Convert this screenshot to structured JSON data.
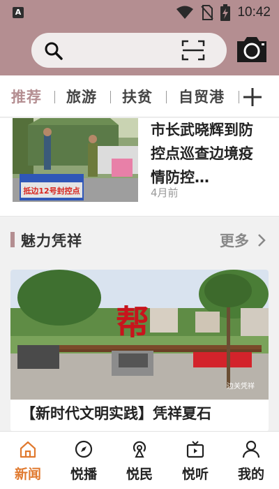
{
  "status_bar": {
    "time": "10:42",
    "app_icon_letter": "A",
    "icons": [
      "wifi-icon",
      "no-sim-icon",
      "battery-charging-icon"
    ]
  },
  "search": {
    "placeholder": "",
    "icons": [
      "search-icon",
      "scan-icon",
      "camera-icon"
    ]
  },
  "tabs": [
    {
      "label": "推荐",
      "active": true
    },
    {
      "label": "旅游",
      "active": false
    },
    {
      "label": "扶贫",
      "active": false
    },
    {
      "label": "自贸港",
      "active": false
    }
  ],
  "tab_add_icon": "plus-icon",
  "news": {
    "title": "市长武晓辉到防控点巡查边境疫情防控…",
    "time": "4月前",
    "thumb_banner": "抵边12号封控点"
  },
  "section": {
    "title": "魅力凭祥",
    "more": "更多"
  },
  "feature": {
    "title": "【新时代文明实践】凭祥夏石",
    "watermark": "边关凭祥",
    "sculpture_text": "帮"
  },
  "bottom_nav": [
    {
      "label": "新闻",
      "icon": "home-icon",
      "active": true
    },
    {
      "label": "悦播",
      "icon": "compass-icon",
      "active": false
    },
    {
      "label": "悦民",
      "icon": "broadcast-icon",
      "active": false
    },
    {
      "label": "悦听",
      "icon": "video-icon",
      "active": false
    },
    {
      "label": "我的",
      "icon": "user-icon",
      "active": false
    }
  ],
  "colors": {
    "brand": "#b48e91",
    "active_nav": "#e0792e"
  }
}
